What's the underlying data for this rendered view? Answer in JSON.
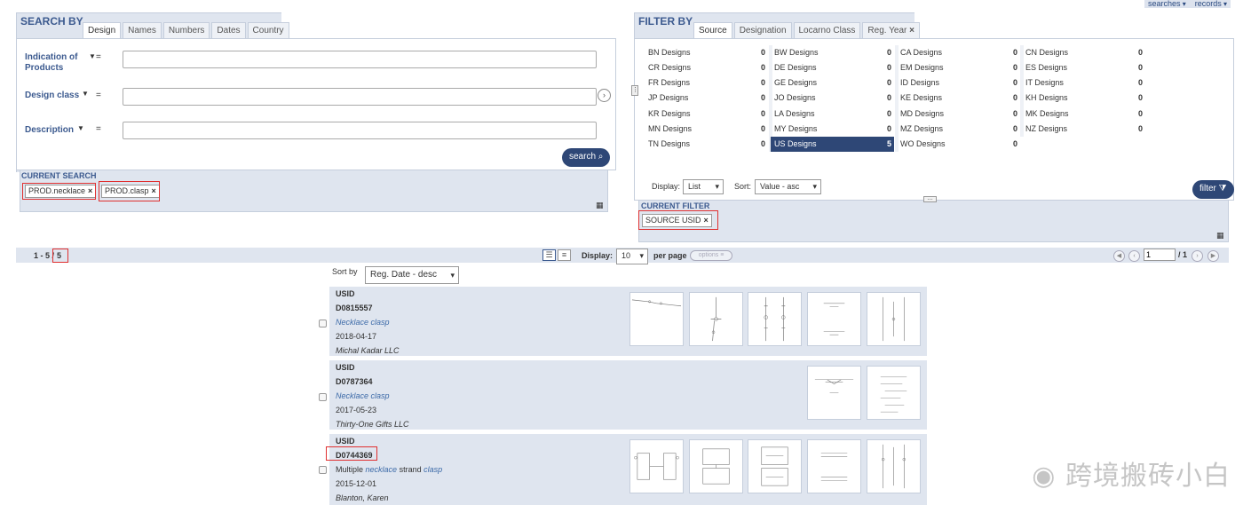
{
  "topbar": {
    "searches": "searches",
    "records": "records"
  },
  "search": {
    "title": "SEARCH BY",
    "tabs": [
      "Design",
      "Names",
      "Numbers",
      "Dates",
      "Country"
    ],
    "fields": [
      {
        "label": "Indication of Products",
        "eq": "=",
        "value": ""
      },
      {
        "label": "Design class",
        "eq": "=",
        "value": ""
      },
      {
        "label": "Description",
        "eq": "=",
        "value": ""
      }
    ],
    "search_button": "search ⌕",
    "current_label": "CURRENT SEARCH",
    "chips": [
      "PROD.necklace",
      "PROD.clasp"
    ]
  },
  "filter": {
    "title": "FILTER BY",
    "tabs": [
      "Source",
      "Designation",
      "Locarno Class",
      "Reg. Year"
    ],
    "grid": [
      [
        {
          "name": "BN Designs",
          "count": "0"
        },
        {
          "name": "CR Designs",
          "count": "0"
        },
        {
          "name": "FR Designs",
          "count": "0"
        },
        {
          "name": "JP Designs",
          "count": "0"
        },
        {
          "name": "KR Designs",
          "count": "0"
        },
        {
          "name": "MN Designs",
          "count": "0"
        },
        {
          "name": "TN Designs",
          "count": "0"
        }
      ],
      [
        {
          "name": "BW Designs",
          "count": "0"
        },
        {
          "name": "DE Designs",
          "count": "0"
        },
        {
          "name": "GE Designs",
          "count": "0"
        },
        {
          "name": "JO Designs",
          "count": "0"
        },
        {
          "name": "LA Designs",
          "count": "0"
        },
        {
          "name": "MY Designs",
          "count": "0"
        },
        {
          "name": "US Designs",
          "count": "5"
        }
      ],
      [
        {
          "name": "CA Designs",
          "count": "0"
        },
        {
          "name": "EM Designs",
          "count": "0"
        },
        {
          "name": "ID Designs",
          "count": "0"
        },
        {
          "name": "KE Designs",
          "count": "0"
        },
        {
          "name": "MD Designs",
          "count": "0"
        },
        {
          "name": "MZ Designs",
          "count": "0"
        },
        {
          "name": "WO Designs",
          "count": "0"
        }
      ],
      [
        {
          "name": "CN Designs",
          "count": "0"
        },
        {
          "name": "ES Designs",
          "count": "0"
        },
        {
          "name": "IT Designs",
          "count": "0"
        },
        {
          "name": "KH Designs",
          "count": "0"
        },
        {
          "name": "MK Designs",
          "count": "0"
        },
        {
          "name": "NZ Designs",
          "count": "0"
        }
      ]
    ],
    "display_label": "Display:",
    "display_value": "List",
    "sort_label": "Sort:",
    "sort_value": "Value - asc",
    "filter_button": "filter ⧩",
    "current_label": "CURRENT FILTER",
    "chip": "SOURCE USID"
  },
  "resultsbar": {
    "range": "1 - 5 /",
    "total": "5",
    "display_label": "Display:",
    "per_page_value": "10",
    "per_page_label": "per page",
    "options_label": "options",
    "page_value": "1",
    "page_total": "/ 1"
  },
  "sortby": {
    "label": "Sort by",
    "value": "Reg. Date - desc"
  },
  "results": [
    {
      "source": "USID",
      "id": "D0815557",
      "title": "Necklace clasp",
      "date": "2018-04-17",
      "owner": "Michal Kadar LLC"
    },
    {
      "source": "USID",
      "id": "D0787364",
      "title": "Necklace clasp",
      "date": "2017-05-23",
      "owner": "Thirty-One Gifts LLC"
    },
    {
      "source": "USID",
      "id": "D0744369",
      "title_pre": "Multiple",
      "title_w1": "necklace",
      "title_mid": "strand",
      "title_w2": "clasp",
      "date": "2015-12-01",
      "owner": "Blanton, Karen"
    }
  ],
  "watermark": "跨境搬砖小白"
}
